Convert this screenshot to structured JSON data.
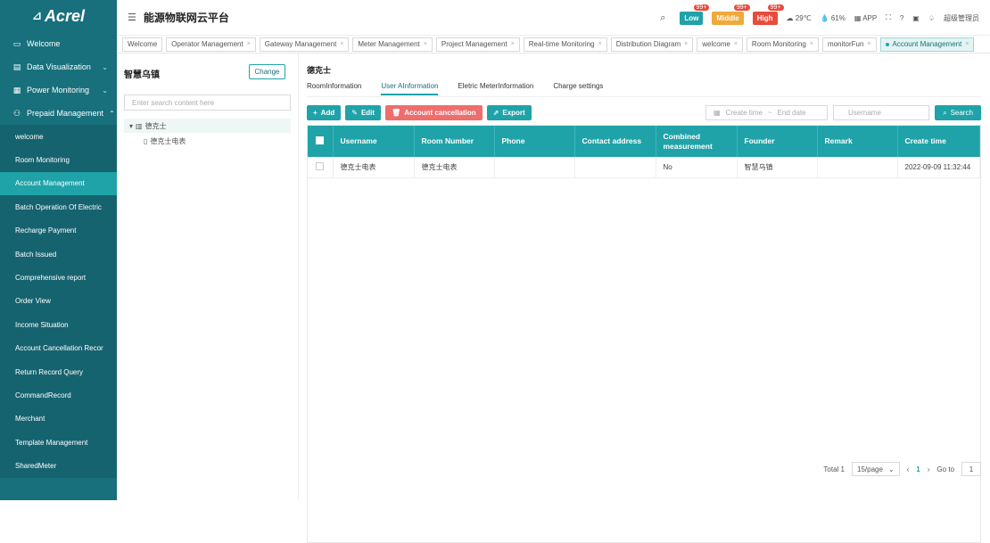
{
  "brand": {
    "logo": "Acrel"
  },
  "header": {
    "title": "能源物联网云平台",
    "alarms": [
      {
        "label": "Low",
        "count": "99+",
        "color": "#1fa3a8"
      },
      {
        "label": "Middle",
        "count": "99+",
        "color": "#f0a93c"
      },
      {
        "label": "High",
        "count": "99+",
        "color": "#e74c3c"
      }
    ],
    "temperature": "29℃",
    "humidity": "61%",
    "app": "APP",
    "user": "超级管理员"
  },
  "tabs": [
    {
      "label": "Welcome"
    },
    {
      "label": "Operator Management"
    },
    {
      "label": "Gateway Management"
    },
    {
      "label": "Meter Management"
    },
    {
      "label": "Project Management"
    },
    {
      "label": "Real-time Monitoring"
    },
    {
      "label": "Distribution Diagram"
    },
    {
      "label": "welcome"
    },
    {
      "label": "Room Monitoring"
    },
    {
      "label": "monitorFun"
    },
    {
      "label": "Account Management"
    }
  ],
  "sidebar": {
    "top": [
      {
        "label": "Welcome"
      },
      {
        "label": "Data Visualization"
      },
      {
        "label": "Power Monitoring"
      },
      {
        "label": "Prepaid Management"
      }
    ],
    "sub": [
      {
        "label": "welcome"
      },
      {
        "label": "Room Monitoring"
      },
      {
        "label": "Account Management"
      },
      {
        "label": "Batch Operation Of Electric"
      },
      {
        "label": "Recharge Payment"
      },
      {
        "label": "Batch Issued"
      },
      {
        "label": "Comprehensive report"
      },
      {
        "label": "Order View"
      },
      {
        "label": "Income Situation"
      },
      {
        "label": "Account Cancellation Recor"
      },
      {
        "label": "Return Record Query"
      },
      {
        "label": "CommandRecord"
      },
      {
        "label": "Merchant"
      },
      {
        "label": "Template Management"
      },
      {
        "label": "SharedMeter"
      }
    ]
  },
  "left": {
    "org": "智慧乌镇",
    "change": "Change",
    "search_placeholder": "Enter search content here",
    "root": "德克士",
    "child": "德克士电表"
  },
  "main": {
    "account": "德克士",
    "subtabs": [
      "RoomInformation",
      "User AInformation",
      "Eletric MeterInformation",
      "Charge settings"
    ],
    "buttons": {
      "add": "Add",
      "edit": "Edit",
      "cancel": "Account cancellation",
      "export": "Export",
      "search": "Search"
    },
    "date_start": "Create time",
    "date_end": "End date",
    "username_placeholder": "Username"
  },
  "table": {
    "headers": [
      "Username",
      "Room Number",
      "Phone",
      "Contact address",
      "Combined measurement",
      "Founder",
      "Remark",
      "Create time"
    ],
    "rows": [
      [
        "德克士电表",
        "德克士电表",
        "",
        "",
        "No",
        "智慧乌镇",
        "",
        "2022-09-09 11:32:44"
      ]
    ]
  },
  "pagination": {
    "total": "Total 1",
    "per_page": "15/page",
    "page": "1",
    "goto": "Go to",
    "goto_value": "1"
  }
}
